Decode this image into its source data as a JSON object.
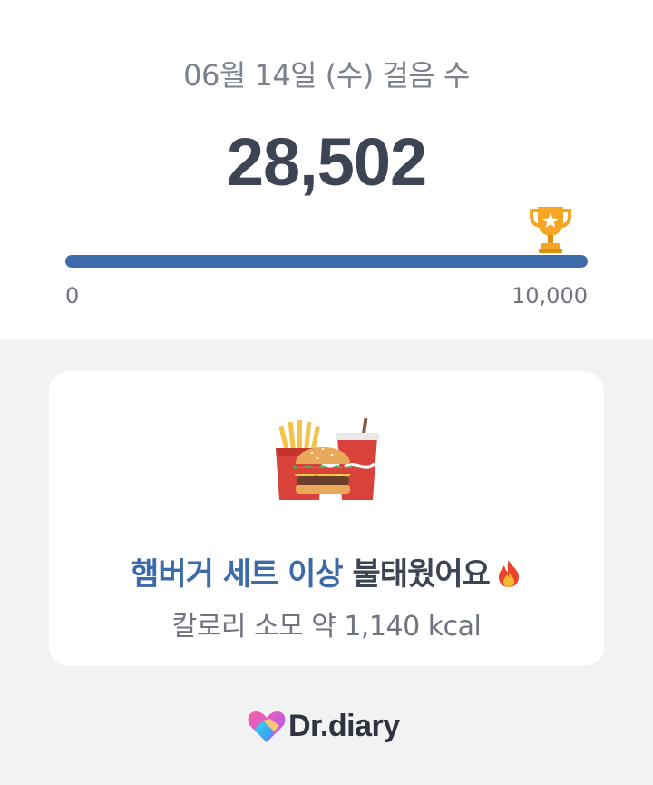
{
  "header": {
    "date_label": "06월 14일 (수) 걸음 수",
    "steps": "28,502"
  },
  "progress": {
    "value": 28502,
    "goal": 10000,
    "fraction": 1.0,
    "min_label": "0",
    "max_label": "10,000",
    "bar_color": "#3d6aa9",
    "track_color": "#dfe3ea"
  },
  "card": {
    "food_icon": "hamburger-set-icon",
    "headline_highlight": "햄버거 세트 이상",
    "headline_rest": " 불태웠어요",
    "headline_emoji_icon": "fire-icon",
    "calories": "칼로리 소모 약 1,140 kcal"
  },
  "footer": {
    "brand_logo_icon": "heart-logo-icon",
    "brand_name": "Dr.diary"
  },
  "colors": {
    "accent": "#3d6aa9",
    "text_dark": "#3d4454",
    "text_muted": "#6f7480",
    "trophy": "#f2a11c"
  }
}
